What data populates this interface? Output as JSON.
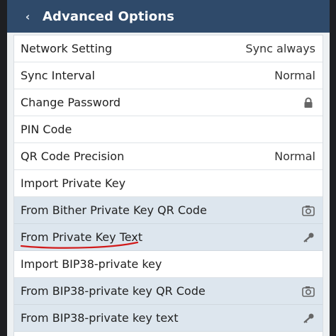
{
  "header": {
    "title": "Advanced Options",
    "back_glyph": "‹"
  },
  "rows": [
    {
      "label": "Network Setting",
      "value": "Sync always"
    },
    {
      "label": "Sync Interval",
      "value": "Normal"
    },
    {
      "label": "Change Password",
      "icon": "lock-icon"
    },
    {
      "label": "PIN Code"
    },
    {
      "label": "QR Code Precision",
      "value": "Normal"
    },
    {
      "label": "Import Private Key"
    },
    {
      "label": "From Bither Private Key QR Code",
      "icon": "camera-icon",
      "highlighted": true
    },
    {
      "label": "From Private Key Text",
      "icon": "key-icon",
      "highlighted": true
    },
    {
      "label": "Import BIP38-private key"
    },
    {
      "label": "From BIP38-private key QR Code",
      "icon": "camera-icon",
      "highlighted": true
    },
    {
      "label": "From BIP38-private key text",
      "icon": "key-icon",
      "highlighted": true
    }
  ],
  "colors": {
    "header_bg": "#2f4a6a",
    "highlight_bg": "#dde6ee",
    "annotation": "#d11a1a"
  }
}
